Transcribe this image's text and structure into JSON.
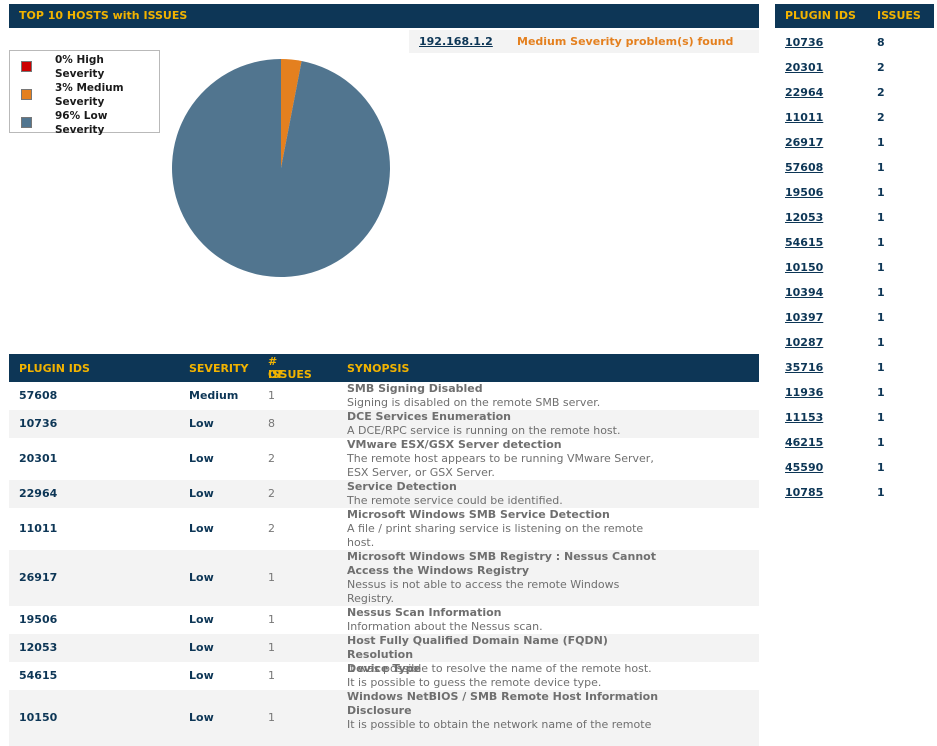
{
  "top_panel": {
    "title": "TOP 10 HOSTS with ISSUES",
    "legend": [
      {
        "label": "0% High Severity",
        "color": "#cc0000",
        "percent": 0
      },
      {
        "label": "3% Medium Severity",
        "color": "#e4801f",
        "percent": 3
      },
      {
        "label": "96% Low Severity",
        "color": "#51758f",
        "percent": 96
      }
    ],
    "host": {
      "ip": "192.168.1.2",
      "problem": "Medium Severity problem(s) found"
    }
  },
  "chart_data": {
    "type": "pie",
    "categories": [
      "High Severity",
      "Medium Severity",
      "Low Severity"
    ],
    "values": [
      0,
      3,
      96
    ],
    "colors": [
      "#cc0000",
      "#e4801f",
      "#51758f"
    ],
    "legend_position": "top-left"
  },
  "right_panel": {
    "col_plugin": "PLUGIN IDS",
    "col_issues": "ISSUES",
    "rows": [
      {
        "id": "10736",
        "issues": "8"
      },
      {
        "id": "20301",
        "issues": "2"
      },
      {
        "id": "22964",
        "issues": "2"
      },
      {
        "id": "11011",
        "issues": "2"
      },
      {
        "id": "26917",
        "issues": "1"
      },
      {
        "id": "57608",
        "issues": "1"
      },
      {
        "id": "19506",
        "issues": "1"
      },
      {
        "id": "12053",
        "issues": "1"
      },
      {
        "id": "54615",
        "issues": "1"
      },
      {
        "id": "10150",
        "issues": "1"
      },
      {
        "id": "10394",
        "issues": "1"
      },
      {
        "id": "10397",
        "issues": "1"
      },
      {
        "id": "10287",
        "issues": "1"
      },
      {
        "id": "35716",
        "issues": "1"
      },
      {
        "id": "11936",
        "issues": "1"
      },
      {
        "id": "11153",
        "issues": "1"
      },
      {
        "id": "46215",
        "issues": "1"
      },
      {
        "id": "45590",
        "issues": "1"
      },
      {
        "id": "10785",
        "issues": "1"
      }
    ]
  },
  "table": {
    "headers": {
      "plugin": "PLUGIN IDS",
      "severity": "SEVERITY",
      "count_l1": "# OF",
      "count_l2": "ISSUES",
      "synopsis": "SYNOPSIS"
    },
    "rows": [
      {
        "id": "57608",
        "severity": "Medium",
        "count": "1",
        "title": "SMB Signing Disabled",
        "desc": "Signing is disabled on the remote SMB server."
      },
      {
        "id": "10736",
        "severity": "Low",
        "count": "8",
        "title": "DCE Services Enumeration",
        "desc": "A DCE/RPC service is running on the remote host."
      },
      {
        "id": "20301",
        "severity": "Low",
        "count": "2",
        "title": "VMware ESX/GSX Server detection",
        "desc": "The remote host appears to be running VMware Server, ESX Server, or GSX Server."
      },
      {
        "id": "22964",
        "severity": "Low",
        "count": "2",
        "title": "Service Detection",
        "desc": "The remote service could be identified."
      },
      {
        "id": "11011",
        "severity": "Low",
        "count": "2",
        "title": "Microsoft Windows SMB Service Detection",
        "desc": "A file / print sharing service is listening on the remote host."
      },
      {
        "id": "26917",
        "severity": "Low",
        "count": "1",
        "title": "Microsoft Windows SMB Registry : Nessus Cannot Access the Windows Registry",
        "desc": "Nessus is not able to access the remote Windows Registry."
      },
      {
        "id": "19506",
        "severity": "Low",
        "count": "1",
        "title": "Nessus Scan Information",
        "desc": "Information about the Nessus scan."
      },
      {
        "id": "12053",
        "severity": "Low",
        "count": "1",
        "title": "Host Fully Qualified Domain Name (FQDN) Resolution",
        "desc": "It was possible to resolve the name of the remote host."
      },
      {
        "id": "54615",
        "severity": "Low",
        "count": "1",
        "title": "Device Type",
        "desc": "It is possible to guess the remote device type."
      },
      {
        "id": "10150",
        "severity": "Low",
        "count": "1",
        "title": "Windows NetBIOS / SMB Remote Host Information Disclosure",
        "desc": "It is possible to obtain the network name of the remote"
      }
    ]
  }
}
